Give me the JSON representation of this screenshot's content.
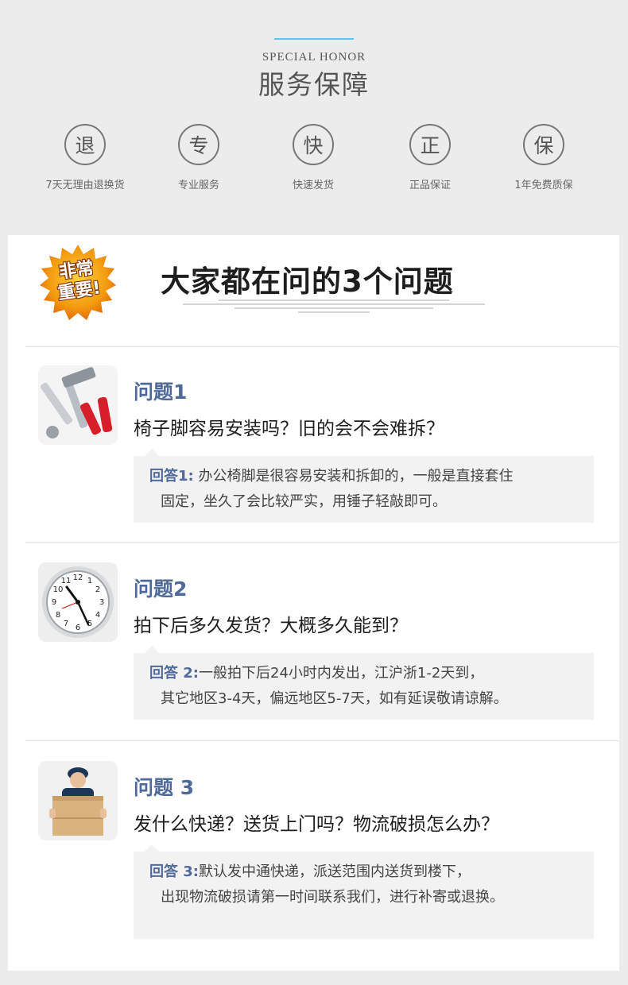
{
  "header": {
    "title_en": "SPECIAL HONOR",
    "title_zh": "服务保障"
  },
  "services": [
    {
      "icon_char": "退",
      "icon": "return-icon",
      "label": "7天无理由退换货"
    },
    {
      "icon_char": "专",
      "icon": "pro-icon",
      "label": "专业服务"
    },
    {
      "icon_char": "快",
      "icon": "fast-icon",
      "label": "快速发货"
    },
    {
      "icon_char": "正",
      "icon": "genuine-icon",
      "label": "正品保证"
    },
    {
      "icon_char": "保",
      "icon": "warranty-icon",
      "label": "1年免费质保"
    }
  ],
  "faq": {
    "badge_line1": "非常",
    "badge_line2": "重要!",
    "title": "大家都在问的3个问题",
    "items": [
      {
        "thumb": "tools-icon",
        "q_label": "问题1",
        "question": "椅子脚容易安装吗？旧的会不会难拆？",
        "a_label": "回答1:",
        "answer_line1": "办公椅脚是很容易安装和拆卸的，一般是直接套住",
        "answer_line2": "固定，坐久了会比较严实，用锤子轻敲即可。"
      },
      {
        "thumb": "clock-icon",
        "q_label": "问题2",
        "question": "拍下后多久发货？大概多久能到？",
        "a_label": "回答 2:",
        "answer_line1": "一般拍下后24小时内发出，江沪浙1-2天到，",
        "answer_line2": "其它地区3-4天，偏远地区5-7天，如有延误敬请谅解。"
      },
      {
        "thumb": "courier-icon",
        "q_label": "问题 3",
        "question": "发什么快递？送货上门吗？物流破损怎么办？",
        "a_label": "回答 3:",
        "answer_line1": "默认发中通快递，派送范围内送货到楼下，",
        "answer_line2": "出现物流破损请第一时间联系我们，进行补寄或退换。"
      }
    ]
  },
  "colors": {
    "accent_line": "#5bc8ea",
    "question_blue": "#4f6a9a",
    "badge_orange": "#f08a00"
  }
}
